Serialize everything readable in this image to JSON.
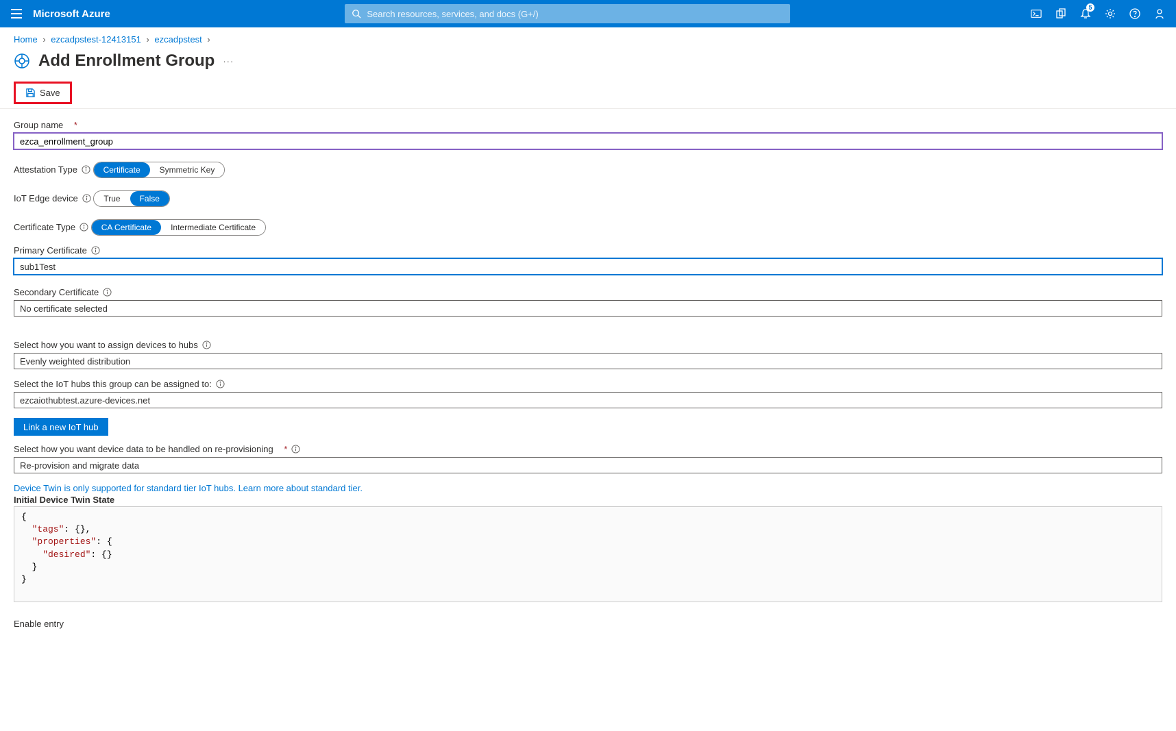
{
  "topbar": {
    "brand": "Microsoft Azure",
    "search_placeholder": "Search resources, services, and docs (G+/)",
    "notif_count": "5"
  },
  "breadcrumb": {
    "items": [
      "Home",
      "ezcadpstest-12413151",
      "ezcadpstest"
    ]
  },
  "title": {
    "text": "Add Enrollment Group",
    "more": "···"
  },
  "cmdbar": {
    "save_label": "Save"
  },
  "form": {
    "group_name_label": "Group name",
    "group_name_value": "ezca_enrollment_group",
    "attestation_type_label": "Attestation Type",
    "attestation_options": {
      "a": "Certificate",
      "b": "Symmetric Key"
    },
    "iot_edge_label": "IoT Edge device",
    "iot_edge_options": {
      "a": "True",
      "b": "False"
    },
    "cert_type_label": "Certificate Type",
    "cert_type_options": {
      "a": "CA Certificate",
      "b": "Intermediate Certificate"
    },
    "primary_cert_label": "Primary Certificate",
    "primary_cert_value": "sub1Test",
    "secondary_cert_label": "Secondary Certificate",
    "secondary_cert_value": "No certificate selected",
    "assign_hubs_label": "Select how you want to assign devices to hubs",
    "assign_hubs_value": "Evenly weighted distribution",
    "iot_hubs_label": "Select the IoT hubs this group can be assigned to:",
    "iot_hubs_value": "ezcaiothubtest.azure-devices.net",
    "link_hub_button": "Link a new IoT hub",
    "reprov_label": "Select how you want device data to be handled on re-provisioning",
    "reprov_value": "Re-provision and migrate data",
    "twin_hint_pre": "Device Twin is only supported for standard tier IoT hubs. ",
    "twin_hint_link": "Learn more about standard tier.",
    "twin_header": "Initial Device Twin State",
    "twin_code": {
      "l1": "{",
      "l2a": "  \"tags\"",
      "l2b": ": {},",
      "l3a": "  \"properties\"",
      "l3b": ": {",
      "l4a": "    \"desired\"",
      "l4b": ": {}",
      "l5": "  }",
      "l6": "}"
    },
    "enable_entry_label": "Enable entry"
  }
}
